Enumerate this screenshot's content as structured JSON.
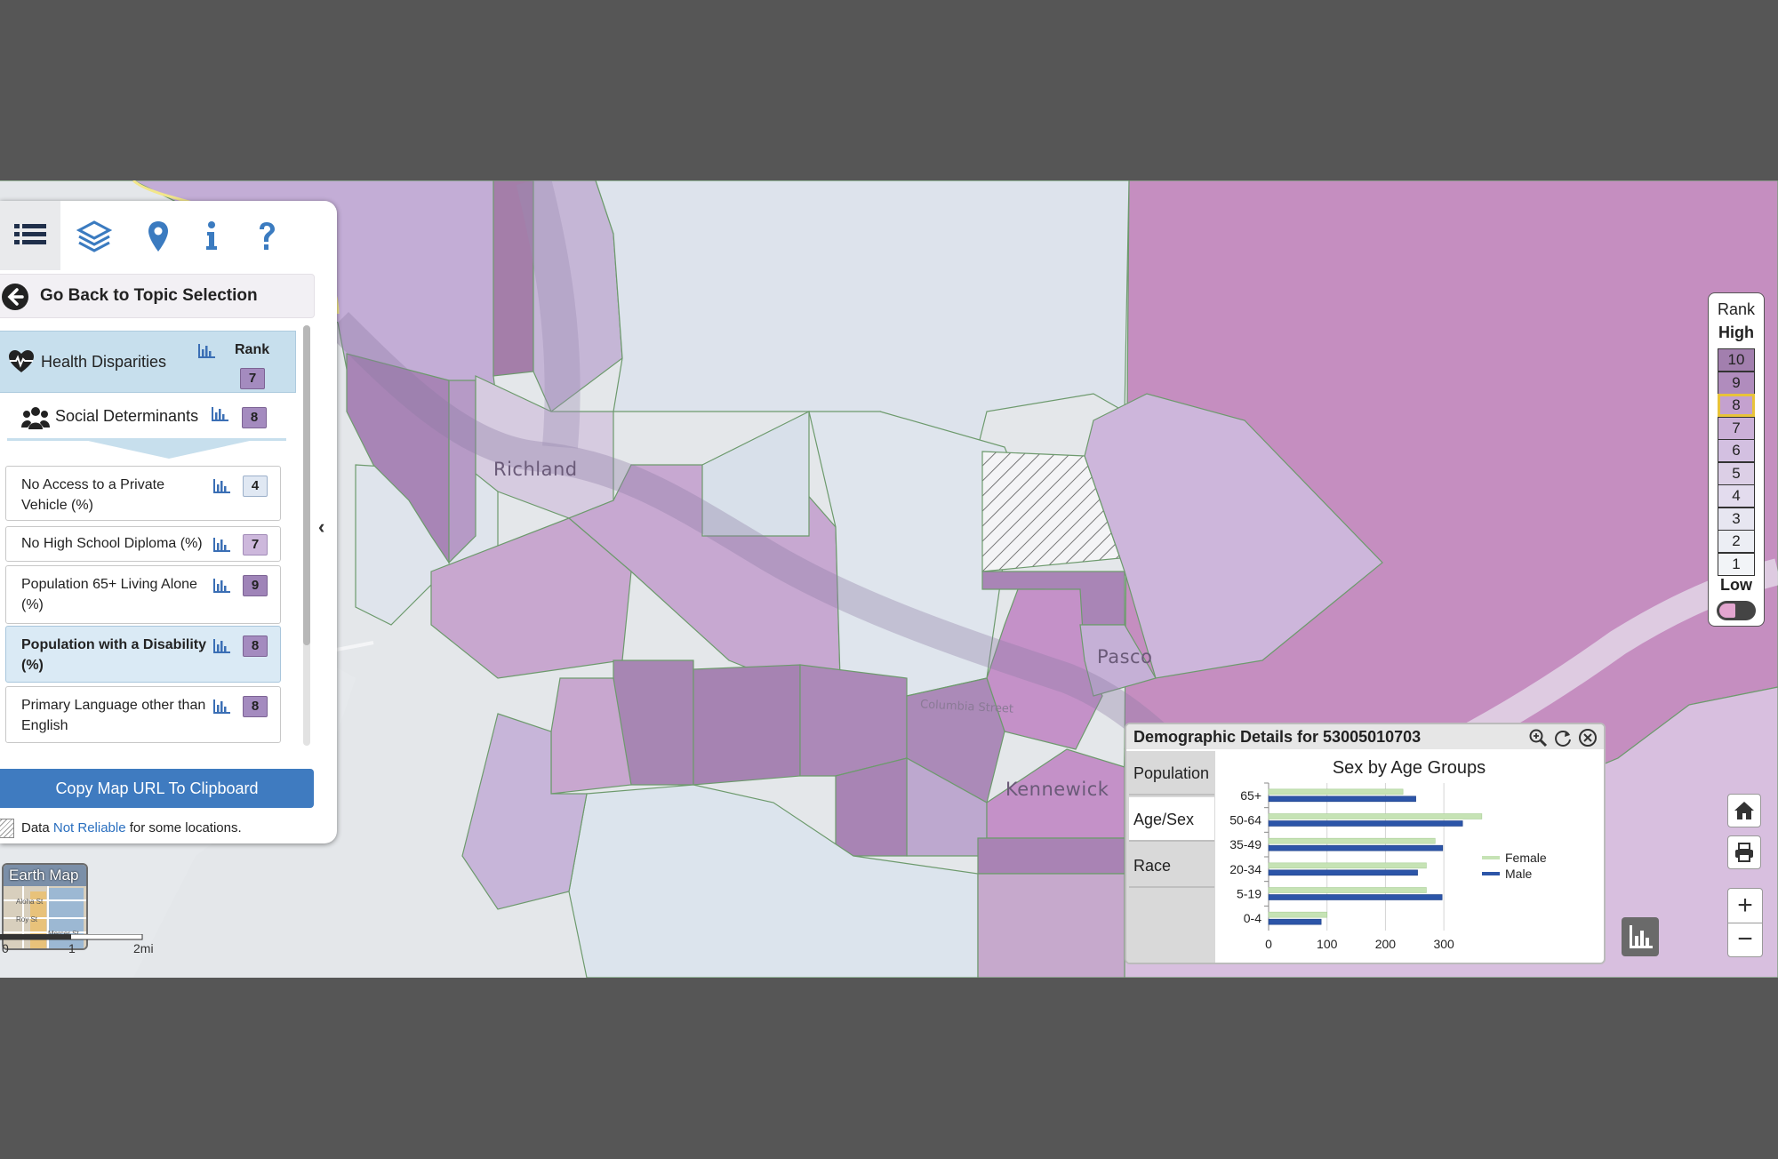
{
  "map": {
    "places": [
      "Richland",
      "Pasco",
      "Kennewick"
    ],
    "road": "Columbia Street",
    "colors": {
      "background": "#e6e9ec",
      "rank_low": "#d9e2ec",
      "rank_mid": "#cbb6d8",
      "rank_high": "#a87fb8",
      "rank_top": "#c58ec0"
    }
  },
  "toolbar": {
    "icons": [
      "list-icon",
      "layers-icon",
      "location-pin-icon",
      "info-icon",
      "help-icon"
    ]
  },
  "panel": {
    "back_label": "Go Back to Topic Selection",
    "rank_header": "Rank",
    "topics": [
      {
        "label": "Health Disparities",
        "rank": "7",
        "icon": "heartbeat-icon"
      },
      {
        "label": "Social Determinants",
        "rank": "8",
        "icon": "people-icon"
      }
    ],
    "items": [
      {
        "label": "No Access to a Private Vehicle (%)",
        "rank": "4"
      },
      {
        "label": "No High School Diploma (%)",
        "rank": "7"
      },
      {
        "label": "Population 65+ Living Alone (%)",
        "rank": "9"
      },
      {
        "label": "Population with a Disability (%)",
        "rank": "8"
      },
      {
        "label": "Primary Language other than English",
        "rank": "8"
      }
    ],
    "copy_button": "Copy Map URL To Clipboard",
    "note_prefix": "Data",
    "note_link": "Not Reliable",
    "note_suffix": "for some locations."
  },
  "basemap": {
    "label": "Earth Map",
    "streets": [
      "Aloha St",
      "Roy St",
      "Mercer St"
    ]
  },
  "scale": {
    "labels": [
      "0",
      "1",
      "2mi"
    ]
  },
  "rank_legend": {
    "title": "Rank",
    "high": "High",
    "low": "Low",
    "levels": [
      "10",
      "9",
      "8",
      "7",
      "6",
      "5",
      "4",
      "3",
      "2",
      "1"
    ],
    "selected": "8",
    "colors": [
      "#a27fae",
      "#b08cbd",
      "#c4a1cf",
      "#cbb0d8",
      "#d3c0e1",
      "#dccfe6",
      "#e3dcee",
      "#e7e6f1",
      "#eceef4",
      "#f2f4f7"
    ]
  },
  "demographics": {
    "title": "Demographic Details for 53005010703",
    "tabs": [
      "Population",
      "Age/Sex",
      "Race"
    ],
    "active_tab": "Age/Sex"
  },
  "chart_data": {
    "type": "bar",
    "orientation": "horizontal",
    "title": "Sex by Age Groups",
    "categories": [
      "65+",
      "50-64",
      "35-49",
      "20-34",
      "5-19",
      "0-4"
    ],
    "series": [
      {
        "name": "Female",
        "color": "#c6e3b5",
        "values": [
          230,
          365,
          285,
          270,
          270,
          100
        ]
      },
      {
        "name": "Male",
        "color": "#2c55a8",
        "values": [
          252,
          332,
          298,
          255,
          297,
          90
        ]
      }
    ],
    "xlim": [
      0,
      350
    ],
    "xticks": [
      0,
      100,
      200,
      300
    ],
    "grid": true,
    "legend": "right"
  }
}
